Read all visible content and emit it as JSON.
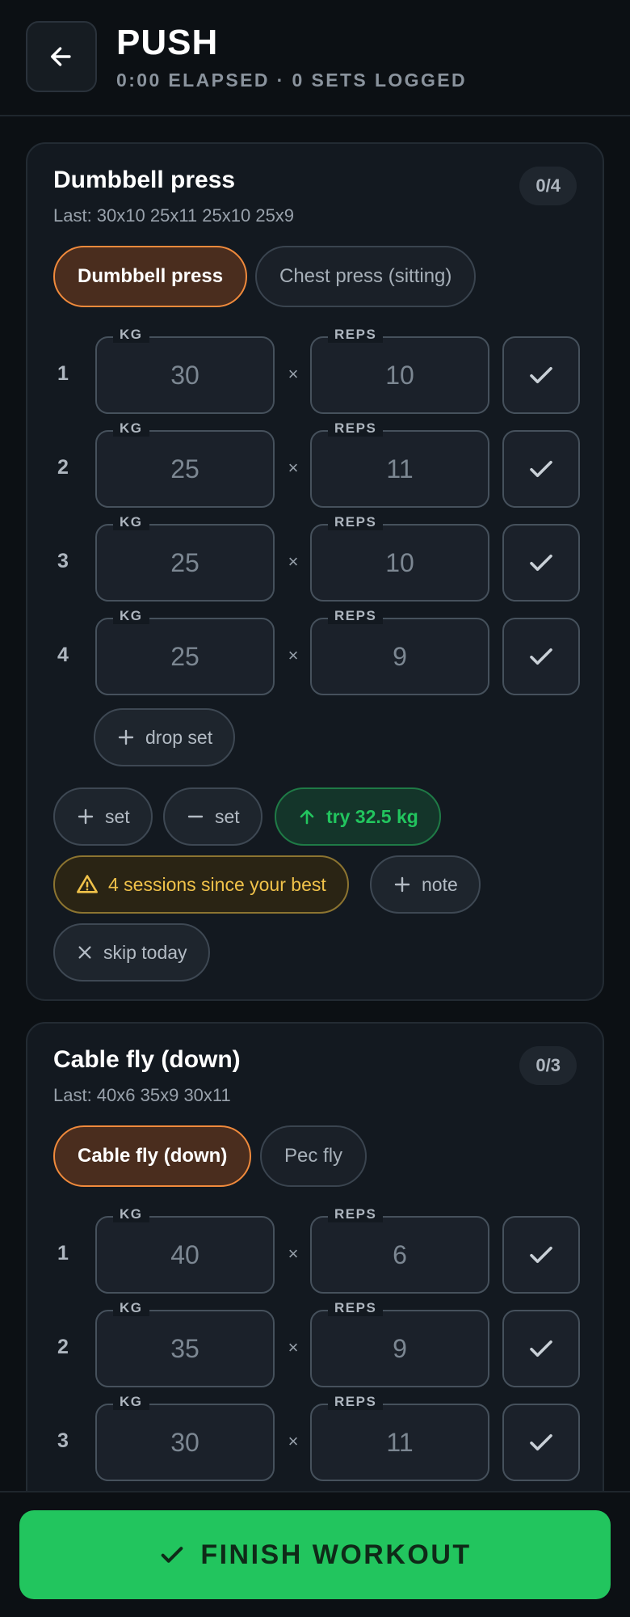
{
  "header": {
    "title": "PUSH",
    "subtitle": "0:00 ELAPSED · 0 SETS LOGGED",
    "back_icon": "arrow-left-icon"
  },
  "exercises": [
    {
      "name": "Dumbbell press",
      "counter": "0/4",
      "last": "Last: 30x10 25x11 25x10 25x9",
      "variants": [
        "Dumbbell press",
        "Chest press (sitting)"
      ],
      "kg_label": "KG",
      "reps_label": "REPS",
      "times": "×",
      "sets": [
        {
          "num": "1",
          "kg": "30",
          "reps": "10"
        },
        {
          "num": "2",
          "kg": "25",
          "reps": "11"
        },
        {
          "num": "3",
          "kg": "25",
          "reps": "10"
        },
        {
          "num": "4",
          "kg": "25",
          "reps": "9"
        }
      ],
      "drop_set": "drop set",
      "actions": {
        "add_set": "set",
        "remove_set": "set",
        "suggest": "try 32.5 kg",
        "warning": "4 sessions since your best",
        "note": "note",
        "skip": "skip today"
      }
    },
    {
      "name": "Cable fly (down)",
      "counter": "0/3",
      "last": "Last: 40x6 35x9 30x11",
      "variants": [
        "Cable fly (down)",
        "Pec fly"
      ],
      "kg_label": "KG",
      "reps_label": "REPS",
      "times": "×",
      "sets": [
        {
          "num": "1",
          "kg": "40",
          "reps": "6"
        },
        {
          "num": "2",
          "kg": "35",
          "reps": "9"
        },
        {
          "num": "3",
          "kg": "30",
          "reps": "11"
        }
      ]
    }
  ],
  "footer": {
    "finish_label": "FINISH WORKOUT"
  },
  "colors": {
    "accent_green": "#22c55e",
    "accent_orange": "#f08a3c",
    "warning_yellow": "#f0c24a"
  }
}
